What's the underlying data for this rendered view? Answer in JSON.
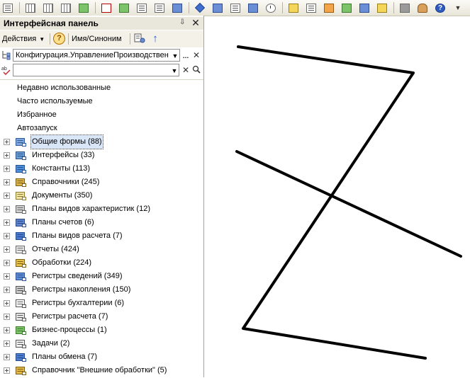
{
  "panel": {
    "title": "Интерфейсная панель",
    "actions_label": "Действия",
    "synonym_label": "Имя/Синоним",
    "config_value": "Конфигурация.УправлениеПроизводствен",
    "search_value": "",
    "plain_items": [
      "Недавно использованные",
      "Часто используемые",
      "Избранное",
      "Автозапуск"
    ],
    "tree_items": [
      {
        "label": "Общие формы (88)",
        "icon": "forms-icon"
      },
      {
        "label": "Интерфейсы (33)",
        "icon": "interfaces-icon"
      },
      {
        "label": "Константы (113)",
        "icon": "constants-icon"
      },
      {
        "label": "Справочники (245)",
        "icon": "catalogs-icon"
      },
      {
        "label": "Документы (350)",
        "icon": "documents-icon"
      },
      {
        "label": "Планы видов характеристик (12)",
        "icon": "characteristic-plans-icon"
      },
      {
        "label": "Планы счетов (6)",
        "icon": "accounts-plans-icon"
      },
      {
        "label": "Планы видов расчета (7)",
        "icon": "calculation-plans-icon"
      },
      {
        "label": "Отчеты (424)",
        "icon": "reports-icon"
      },
      {
        "label": "Обработки (224)",
        "icon": "processing-icon"
      },
      {
        "label": "Регистры сведений (349)",
        "icon": "info-registers-icon"
      },
      {
        "label": "Регистры накопления (150)",
        "icon": "accumulation-registers-icon"
      },
      {
        "label": "Регистры бухгалтерии (6)",
        "icon": "accounting-registers-icon"
      },
      {
        "label": "Регистры расчета (7)",
        "icon": "calculation-registers-icon"
      },
      {
        "label": "Бизнес-процессы (1)",
        "icon": "business-processes-icon"
      },
      {
        "label": "Задачи (2)",
        "icon": "tasks-icon"
      },
      {
        "label": "Планы обмена (7)",
        "icon": "exchange-plans-icon"
      },
      {
        "label": "Справочник \"Внешние обработки\" (5)",
        "icon": "external-processing-icon"
      }
    ]
  },
  "colors": {
    "toolbar_bg": "#ece9dc",
    "selection_bg": "#d9e6f7",
    "drawing_line": "#000000"
  }
}
